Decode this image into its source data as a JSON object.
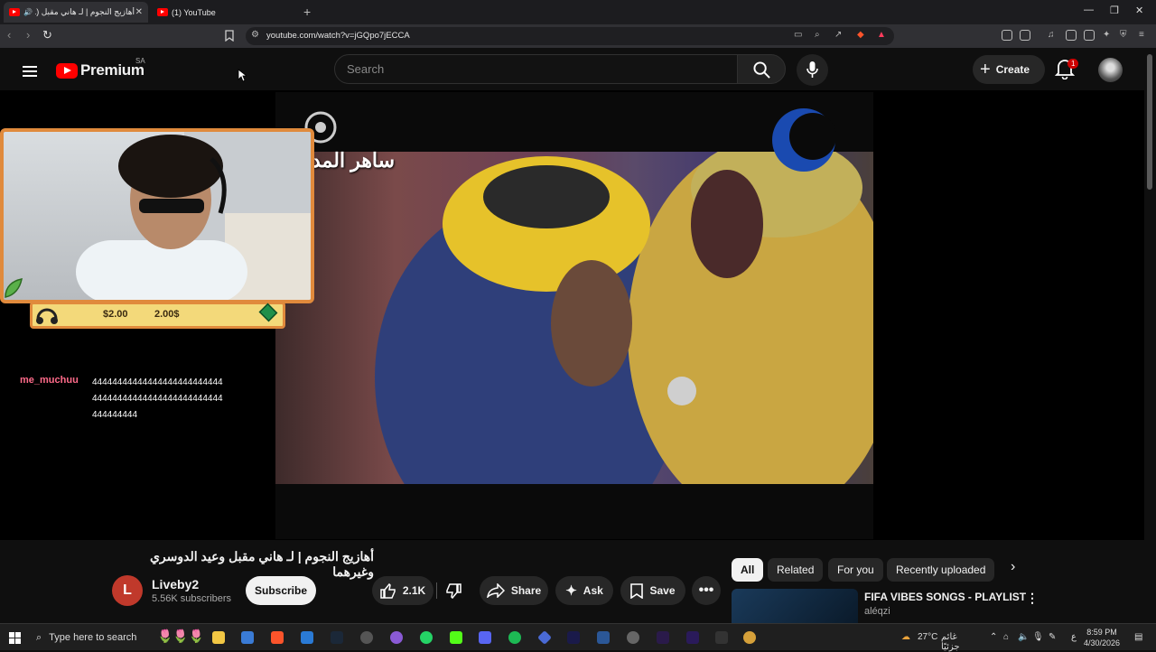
{
  "browser": {
    "tabs": [
      {
        "label": "أهازيج النجوم | لـ هاني مقبل (1)"
      },
      {
        "label": "(1) YouTube"
      }
    ],
    "url": "youtube.com/watch?v=jGQpo7jECCA"
  },
  "header": {
    "logo_text": "Premium",
    "country": "SA",
    "search_placeholder": "Search",
    "create_label": "Create",
    "notif_count": "1"
  },
  "video": {
    "chyron": "ساهر المد",
    "overlay": {
      "amount1": "$2.00",
      "amount2": "2.00$"
    },
    "chat": {
      "user": "me_muchuu",
      "message": "4444444444444444444444444444444444444444444444444444444444444"
    }
  },
  "meta": {
    "title": "أهازيج النجوم | لـ هاني مقبل وعيد الدوسري وغيرهما",
    "channel": "Liveby2",
    "channel_initial": "L",
    "subscribers": "5.56K subscribers",
    "subscribe_label": "Subscribe",
    "likes": "2.1K",
    "share_label": "Share",
    "ask_label": "Ask",
    "save_label": "Save"
  },
  "sidebar": {
    "chips": [
      "All",
      "Related",
      "For you",
      "Recently uploaded"
    ],
    "rec": {
      "title": "FIFA VIBES SONGS - PLAYLIST",
      "channel": "aléqzi"
    }
  },
  "taskbar": {
    "search_placeholder": "Type here to search",
    "weather": "27°C",
    "weather_text": "غائم جزئيًا",
    "lang": "ع",
    "time": "8:59 PM",
    "date": "4/30/2026"
  },
  "colors": {
    "brand_red": "#ff0000",
    "accent_orange": "#e08a3c"
  }
}
